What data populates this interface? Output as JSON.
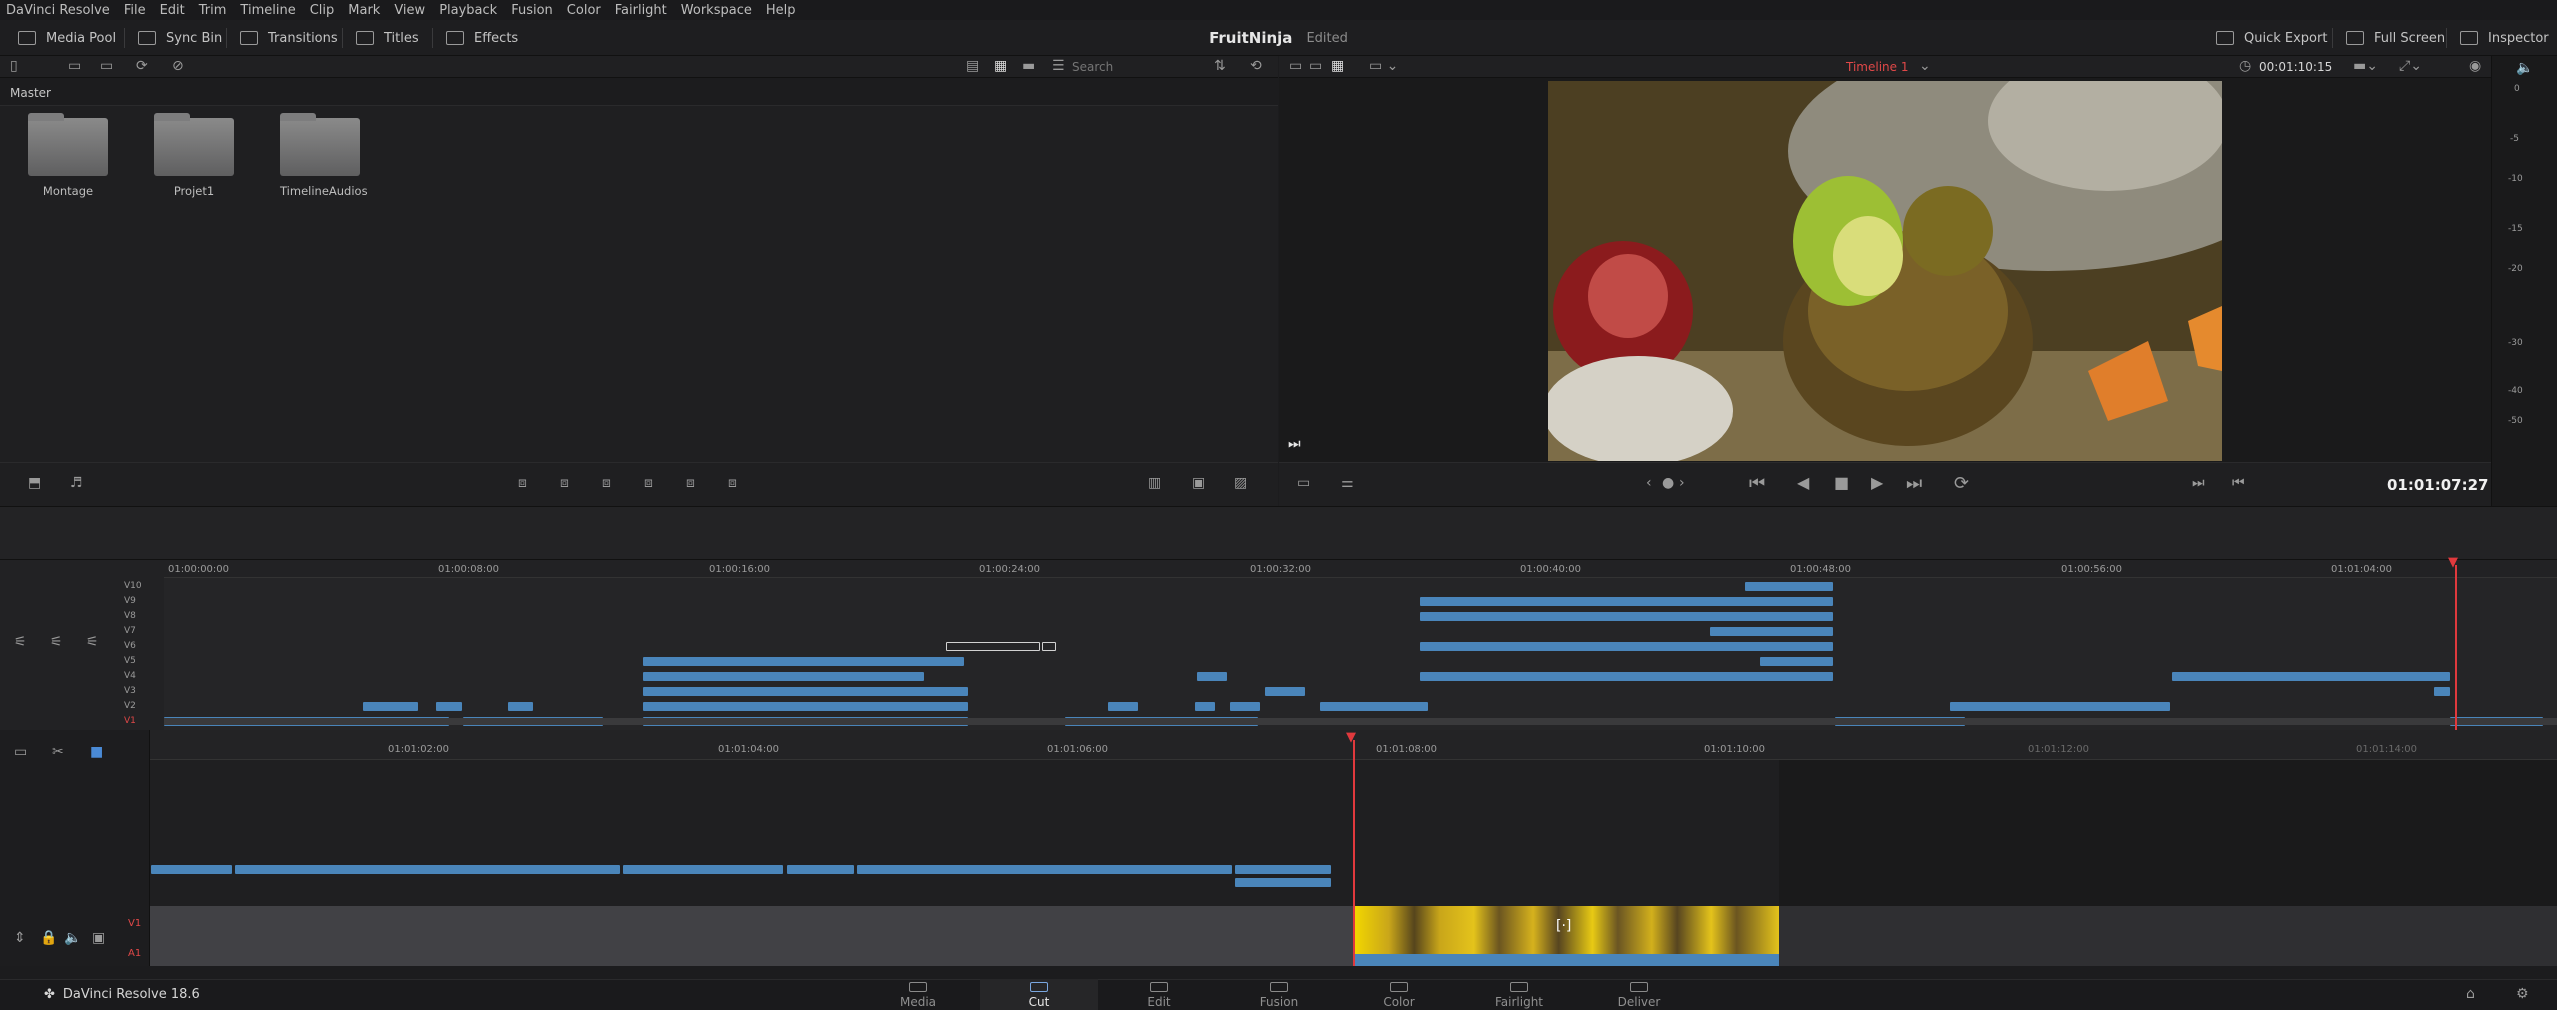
{
  "menu": [
    "DaVinci Resolve",
    "File",
    "Edit",
    "Trim",
    "Timeline",
    "Clip",
    "Mark",
    "View",
    "Playback",
    "Fusion",
    "Color",
    "Fairlight",
    "Workspace",
    "Help"
  ],
  "toolbar": {
    "media_pool": "Media Pool",
    "sync_bin": "Sync Bin",
    "transitions": "Transitions",
    "titles": "Titles",
    "effects": "Effects",
    "quick_export": "Quick Export",
    "full_screen": "Full Screen",
    "inspector": "Inspector"
  },
  "project": {
    "name": "FruitNinja",
    "status": "Edited"
  },
  "media_pool": {
    "search_placeholder": "Search",
    "breadcrumb": "Master",
    "folders": [
      "Montage",
      "Projet1",
      "TimelineAudios"
    ]
  },
  "viewer": {
    "timeline_name": "Timeline 1",
    "source_timecode": "00:01:10:15",
    "timecode": "01:01:07:27"
  },
  "meter": {
    "scale": [
      "0",
      "-5",
      "-10",
      "-15",
      "-20",
      "-30",
      "-40",
      "-50"
    ]
  },
  "upper_timeline": {
    "ticks": [
      "01:00:00:00",
      "01:00:08:00",
      "01:00:16:00",
      "01:00:24:00",
      "01:00:32:00",
      "01:00:40:00",
      "01:00:48:00",
      "01:00:56:00",
      "01:01:04:00"
    ],
    "tracks": [
      "V10",
      "V9",
      "V8",
      "V7",
      "V6",
      "V5",
      "V4",
      "V3",
      "V2",
      "V1"
    ]
  },
  "lower_timeline": {
    "ticks": [
      "01:01:02:00",
      "01:01:04:00",
      "01:01:06:00",
      "01:01:08:00",
      "01:01:10:00",
      "01:01:12:00",
      "01:01:14:00"
    ],
    "tracks": [
      "V1",
      "A1"
    ]
  },
  "pages": [
    "Media",
    "Cut",
    "Edit",
    "Fusion",
    "Color",
    "Fairlight",
    "Deliver"
  ],
  "active_page": "Cut",
  "app_version": "DaVinci Resolve 18.6",
  "colors": {
    "accent": "#4a85ba",
    "playhead": "#e0393d",
    "timeline_label": "#e04848"
  }
}
